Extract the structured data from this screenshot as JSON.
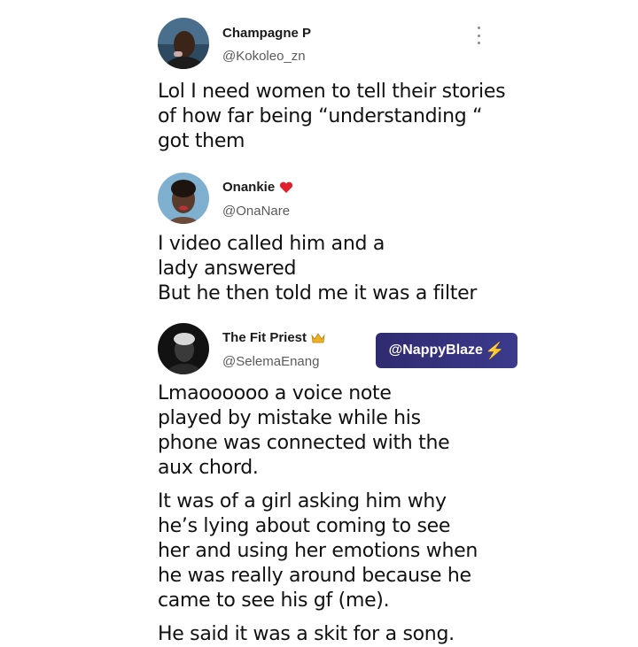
{
  "posts": [
    {
      "display_name": "Champagne P",
      "handle": "@Kokoleo_zn",
      "paragraphs": [
        "Lol I need women to tell their stories of how far being “understanding “ got them"
      ]
    },
    {
      "display_name": "Onankie",
      "name_emoji": "heart-icon",
      "handle": "@OnaNare",
      "paragraphs": [
        "I video called him and a lady answered",
        "But he then told me it was a filter"
      ]
    },
    {
      "display_name": "The Fit Priest",
      "name_emoji": "crown-icon",
      "handle": "@SelemaEnang",
      "paragraphs": [
        "Lmaoooooo a voice note played by mistake while his phone was connected with the aux chord.",
        "It was of a girl asking him why he’s lying about coming to see her and using her emotions when he was really around because he came to see his gf (me).",
        "He said it was a skit for a song."
      ]
    }
  ],
  "watermark": {
    "text": "@NappyBlaze",
    "icon": "lightning-icon",
    "colors": {
      "background": "#342f7a",
      "text": "#ffffff",
      "bolt": "#f6c21b"
    }
  },
  "menu_icon": "more-vertical-icon"
}
